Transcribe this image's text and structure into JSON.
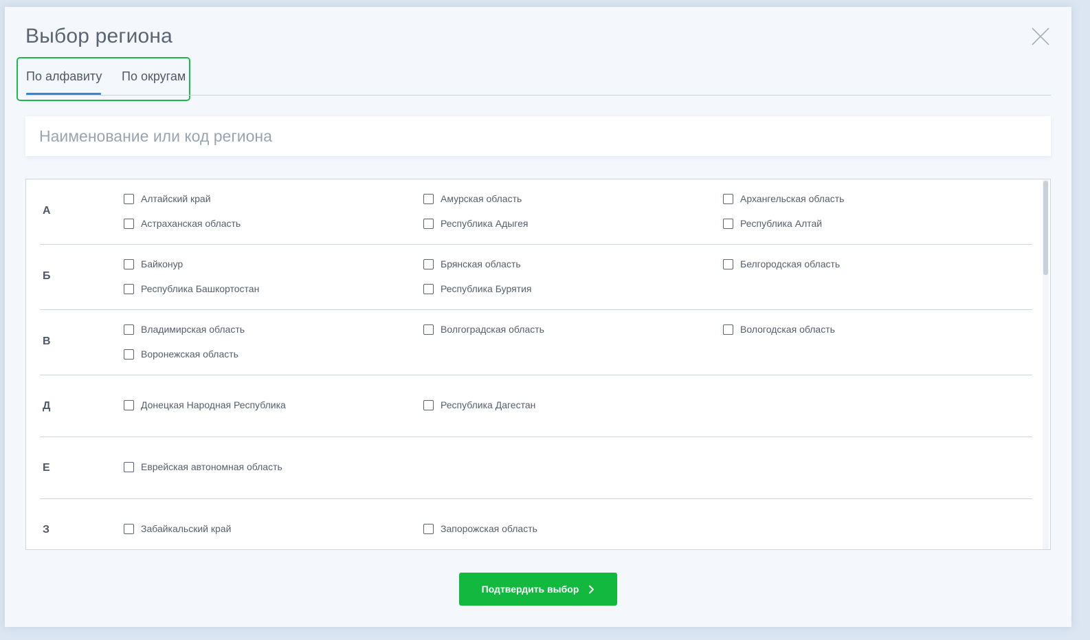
{
  "modal": {
    "title": "Выбор региона"
  },
  "tabs": [
    {
      "label": "По алфавиту",
      "active": true
    },
    {
      "label": "По округам",
      "active": false
    }
  ],
  "search": {
    "placeholder": "Наименование или код региона",
    "value": ""
  },
  "groups": [
    {
      "letter": "А",
      "regions": [
        "Алтайский край",
        "Амурская область",
        "Архангельская область",
        "Астраханская область",
        "Республика Адыгея",
        "Республика Алтай"
      ]
    },
    {
      "letter": "Б",
      "regions": [
        "Байконур",
        "Брянская область",
        "Белгородская область",
        "Республика Башкортостан",
        "Республика Бурятия"
      ]
    },
    {
      "letter": "В",
      "regions": [
        "Владимирская область",
        "Волгоградская область",
        "Вологодская область",
        "Воронежская область"
      ]
    },
    {
      "letter": "Д",
      "regions": [
        "Донецкая Народная Республика",
        "Республика Дагестан"
      ]
    },
    {
      "letter": "Е",
      "regions": [
        "Еврейская автономная область"
      ]
    },
    {
      "letter": "З",
      "regions": [
        "Забайкальский край",
        "Запорожская область"
      ]
    }
  ],
  "confirm": {
    "label": "Подтвердить выбор"
  },
  "colors": {
    "accent_green": "#13b83f",
    "tab_underline": "#2f89d8",
    "highlight_frame": "#20b84a"
  }
}
